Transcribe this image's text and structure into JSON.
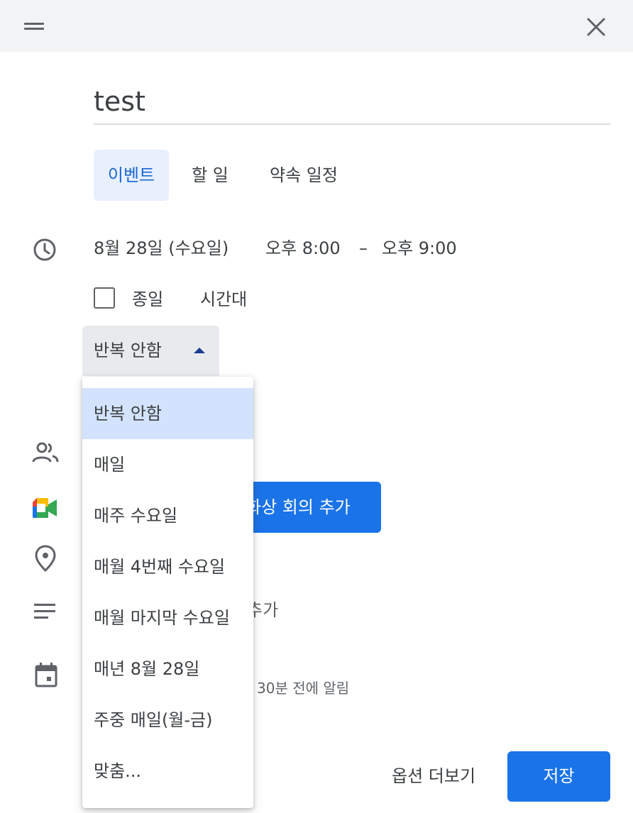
{
  "title": {
    "value": "test"
  },
  "tabs": [
    {
      "label": "이벤트",
      "active": true
    },
    {
      "label": "할 일",
      "active": false
    },
    {
      "label": "약속 일정",
      "active": false
    }
  ],
  "datetime": {
    "date": "8월 28일 (수요일)",
    "start": "오후 8:00",
    "separator": "–",
    "end": "오후 9:00"
  },
  "options": {
    "all_day_label": "종일",
    "all_day_checked": false,
    "timezone_label": "시간대"
  },
  "repeat": {
    "selected": "반복 안함",
    "options": [
      "반복 안함",
      "매일",
      "매주 수요일",
      "매월 4번째 수요일",
      "매월 마지막 수요일",
      "매년 8월 28일",
      "주중 매일(월-금)",
      "맞춤..."
    ]
  },
  "meet_button_label": "화상 회의 추가",
  "description_placeholder": "추가",
  "notification_text": "30분 전에 알림",
  "footer": {
    "more_options": "옵션 더보기",
    "save": "저장"
  },
  "icons": {
    "drag": "drag-handle-icon",
    "close": "close-icon",
    "clock": "clock-icon",
    "people": "people-icon",
    "meet": "google-meet-icon",
    "location": "location-pin-icon",
    "description": "description-lines-icon",
    "calendar": "calendar-icon",
    "caret": "caret-up-icon"
  },
  "colors": {
    "accent": "#1a73e8",
    "active_tab_bg": "#e8f0fe",
    "active_tab_text": "#1967d2",
    "selected_option_bg": "#d3e3fd"
  }
}
